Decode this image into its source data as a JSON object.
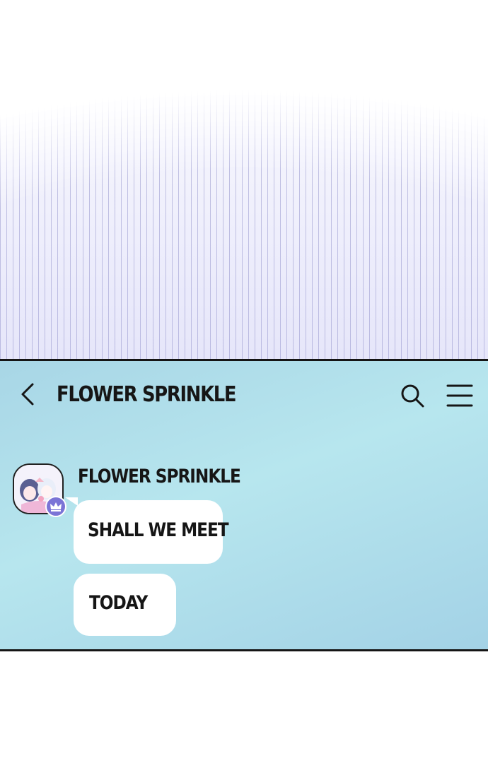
{
  "header": {
    "title": "FLOWER SPRINKLE",
    "back_icon": "chevron-left-icon",
    "search_icon": "search-icon",
    "menu_icon": "hamburger-menu-icon"
  },
  "chat": {
    "sender": "FLOWER SPRINKLE",
    "avatar_badge_icon": "crown-icon",
    "messages": [
      {
        "text": "SHALL WE MEET"
      },
      {
        "text": "TODAY"
      }
    ]
  },
  "colors": {
    "panel_start": "#a8d6e6",
    "panel_end": "#a3d2e6",
    "bubble": "#ffffff",
    "text": "#161616",
    "badge": "#7b74d6"
  }
}
